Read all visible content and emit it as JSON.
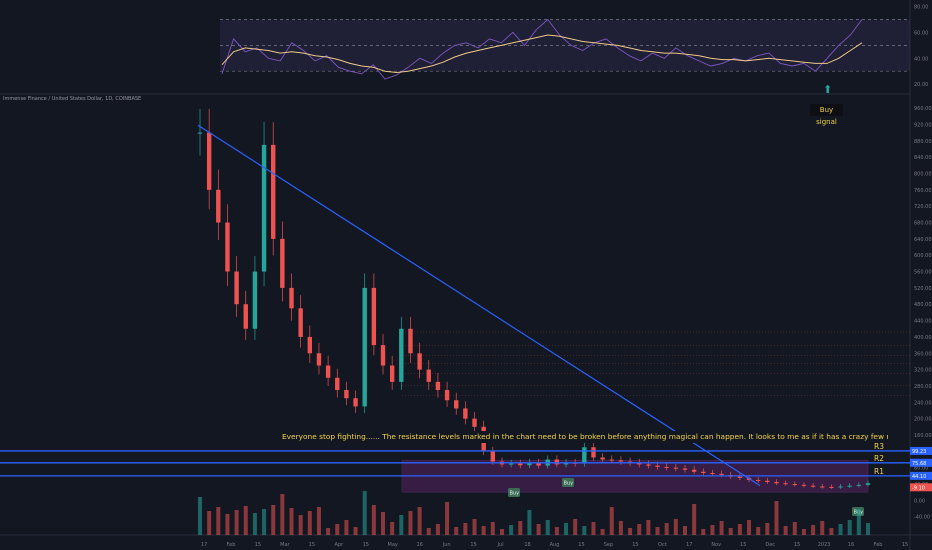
{
  "symbol_title": "Immense Finance / United States Dollar, 1D, COINBASE",
  "annotation": "Everyone stop fighting...... The resistance levels marked in the chart need to be broken before anything magical can happen. It looks to me as if it has a crazy few months than has traded sideways since may.",
  "buy_signal_label": "Buy signal",
  "buy_badge": "Buy",
  "colors": {
    "background": "#131722",
    "trendline": "#2962ff",
    "resistance": "#2962ff",
    "zone": "#7b2a85",
    "bull": "#26a69a",
    "bear": "#ef5350",
    "rsi": "#7e57c2",
    "ma": "#f0c987",
    "note_text": "#f5d547"
  },
  "chart_data": [
    {
      "type": "line",
      "name_panel": "oscillator",
      "yticks": [
        "80.00",
        "60.00",
        "40.00",
        "20.00"
      ],
      "y": {
        "min": 17,
        "max": 82
      },
      "levels": [
        70,
        50,
        30
      ],
      "series": [
        {
          "values": [
            28,
            55,
            45,
            48,
            40,
            38,
            52,
            46,
            38,
            42,
            33,
            30,
            28,
            35,
            24,
            27,
            33,
            40,
            36,
            44,
            50,
            52,
            48,
            55,
            52,
            60,
            50,
            62,
            70,
            58,
            50,
            46,
            52,
            55,
            48,
            42,
            38,
            44,
            40,
            48,
            42,
            38,
            34,
            36,
            40,
            38,
            42,
            44,
            36,
            34,
            36,
            30,
            40,
            50,
            58,
            70
          ]
        },
        {
          "values": [
            35,
            45,
            48,
            47,
            46,
            44,
            45,
            44,
            42,
            41,
            39,
            36,
            34,
            33,
            30,
            29,
            30,
            32,
            34,
            37,
            41,
            44,
            46,
            48,
            50,
            52,
            54,
            56,
            58,
            57,
            55,
            53,
            52,
            51,
            50,
            48,
            46,
            45,
            44,
            44,
            43,
            42,
            40,
            39,
            39,
            38,
            39,
            40,
            39,
            38,
            37,
            36,
            36,
            40,
            46,
            52
          ]
        }
      ]
    },
    {
      "type": "line",
      "name_panel": "price",
      "yticks": [
        "960.00",
        "920.00",
        "880.00",
        "840.00",
        "800.00",
        "760.00",
        "720.00",
        "680.00",
        "640.00",
        "600.00",
        "560.00",
        "520.00",
        "480.00",
        "440.00",
        "400.00",
        "360.00",
        "320.00",
        "280.00",
        "240.00",
        "200.00",
        "160.00",
        "120.00",
        "80.00",
        "40.00",
        "0.00",
        "-40.00"
      ],
      "y": {
        "min": -48,
        "max": 970
      },
      "xticks": [
        "17",
        "Feb",
        "15",
        "Mar",
        "15",
        "Apr",
        "15",
        "May",
        "16",
        "Jun",
        "15",
        "Jul",
        "18",
        "Aug",
        "15",
        "Sep",
        "15",
        "Oct",
        "17",
        "Nov",
        "15",
        "Dec",
        "15",
        "2023",
        "16",
        "Feb",
        "15"
      ],
      "series": [
        {
          "values": [
            900,
            760,
            680,
            560,
            480,
            420,
            560,
            870,
            640,
            520,
            470,
            400,
            360,
            330,
            300,
            270,
            250,
            230,
            520,
            380,
            330,
            290,
            420,
            360,
            320,
            290,
            270,
            245,
            225,
            200,
            180,
            120,
            95,
            88,
            90,
            86,
            92,
            85,
            100,
            88,
            92,
            90,
            130,
            105,
            100,
            98,
            95,
            92,
            88,
            85,
            82,
            80,
            78,
            75,
            70,
            67,
            65,
            62,
            58,
            55,
            50,
            48,
            45,
            42,
            40,
            38,
            36,
            34,
            33,
            32,
            34,
            36,
            38,
            42
          ]
        }
      ],
      "resistance_lines": [
        {
          "label": "R3",
          "value": 121
        },
        {
          "label": "R2",
          "value": 92
        },
        {
          "label": "R1",
          "value": 60
        }
      ],
      "price_tags": [
        "99.23",
        "75.68",
        "44.10",
        "-9.10"
      ],
      "trendline": {
        "from": 918,
        "to": 36
      },
      "zone": {
        "low": 20,
        "high": 98
      }
    }
  ]
}
